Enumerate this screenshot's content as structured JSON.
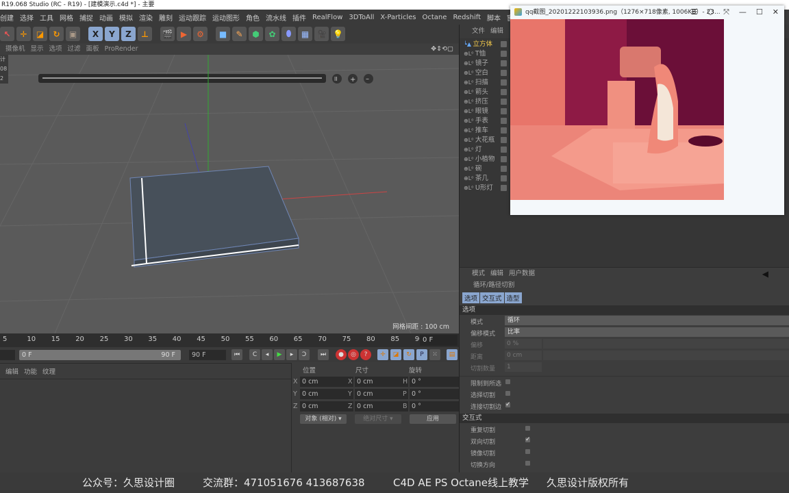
{
  "window": {
    "title": "R19.068 Studio (RC - R19) - [建模演示.c4d *] - 主要"
  },
  "menu": [
    "创建",
    "选择",
    "工具",
    "网格",
    "捕捉",
    "动画",
    "模拟",
    "渲染",
    "雕刻",
    "运动跟踪",
    "运动图形",
    "角色",
    "流水线",
    "插件",
    "RealFlow",
    "3DToAll",
    "X-Particles",
    "Octane",
    "Redshift",
    "脚本",
    "窗口",
    "帮助"
  ],
  "toolbar": {
    "axis_buttons": [
      "X",
      "Y",
      "Z"
    ],
    "icons": [
      "select-arrow",
      "move",
      "scale",
      "rotate",
      "recent-tools",
      "x-axis",
      "y-axis",
      "z-axis",
      "coordinate-system",
      "render-view",
      "render-to-picture-viewer",
      "render-settings",
      "cube",
      "pen",
      "subdivision",
      "cloner",
      "deformer",
      "floor",
      "camera",
      "light"
    ]
  },
  "viewport": {
    "menu": [
      "摄像机",
      "显示",
      "选项",
      "过滤",
      "面板",
      "ProRender"
    ],
    "grid_label": "网格间距 : 100 cm",
    "left_hud": [
      "计",
      "08",
      "2"
    ]
  },
  "timeline": {
    "ticks": [
      "5",
      "10",
      "15",
      "20",
      "25",
      "30",
      "35",
      "40",
      "45",
      "50",
      "55",
      "60",
      "65",
      "70",
      "75",
      "80",
      "85",
      "90"
    ],
    "current_frame": "0 F",
    "range_start": "0 F",
    "range_end": "90 F",
    "end_field": "90 F"
  },
  "materials": {
    "menu": [
      "编辑",
      "功能",
      "纹理"
    ]
  },
  "coordinates": {
    "headers": [
      "位置",
      "尺寸",
      "旋转"
    ],
    "rows": [
      {
        "pos_axis": "X",
        "pos": "0 cm",
        "size_axis": "X",
        "size": "0 cm",
        "rot_axis": "H",
        "rot": "0 °"
      },
      {
        "pos_axis": "Y",
        "pos": "0 cm",
        "size_axis": "Y",
        "size": "0 cm",
        "rot_axis": "P",
        "rot": "0 °"
      },
      {
        "pos_axis": "Z",
        "pos": "0 cm",
        "size_axis": "Z",
        "size": "0 cm",
        "rot_axis": "B",
        "rot": "0 °"
      }
    ],
    "mode_dropdown": "对象 (相对)",
    "size_dropdown": "绝对尺寸",
    "apply_button": "应用"
  },
  "object_manager": {
    "menu": [
      "文件",
      "编辑"
    ],
    "objects": [
      "立方体",
      "T恤",
      "镜子",
      "空白",
      "扫描",
      "箭头",
      "挤压",
      "眼镜",
      "手表",
      "推车",
      "大花瓶",
      "灯",
      "小植物",
      "碗",
      "茶几",
      "U形灯"
    ],
    "selected_color": "#f2c94c"
  },
  "attributes": {
    "menu": [
      "模式",
      "编辑",
      "用户数据"
    ],
    "tool_name": "循环/路径切割",
    "tabs": [
      "选项",
      "交互式",
      "造型"
    ],
    "section_options": "选项",
    "mode_label": "模式",
    "mode_value": "循环",
    "offset_mode_label": "偏移模式",
    "offset_mode_value": "比率",
    "offset_label": "偏移",
    "offset_value": "0 %",
    "distance_label": "距离",
    "distance_value": "0 cm",
    "cuts_label": "切割数量",
    "cuts_value": "1",
    "checkboxes": [
      {
        "label": "限制到所选",
        "checked": false
      },
      {
        "label": "选择切割",
        "checked": false
      },
      {
        "label": "连接切割边",
        "checked": true
      }
    ],
    "section_interactive": "交互式",
    "interactive_checkboxes": [
      {
        "label": "重复切割",
        "checked": false
      },
      {
        "label": "双向切割",
        "checked": true
      },
      {
        "label": "镜像切割",
        "checked": false
      },
      {
        "label": "切换方向",
        "checked": false
      }
    ]
  },
  "image_viewer": {
    "title": "qq截图_20201222103936.png（1276×718像素, 1006KB）- 23...",
    "buttons": [
      "menu-icon",
      "rotate-icon",
      "fullscreen-icon",
      "minimize-icon",
      "maximize-icon",
      "close-icon"
    ]
  },
  "watermark": {
    "wechat": "公众号：久思设计圈",
    "group": "交流群：471051676   413687638",
    "course": "C4D AE PS Octane线上教学",
    "copyright": "久思设计版权所有"
  },
  "check_mark": "✓"
}
